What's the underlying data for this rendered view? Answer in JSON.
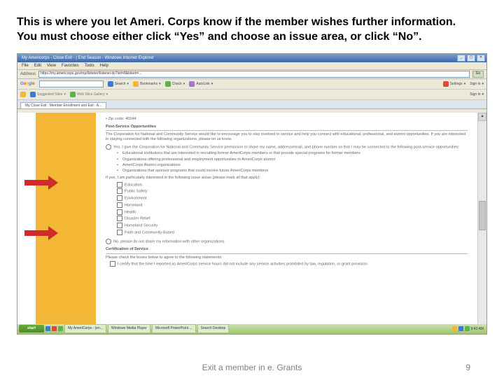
{
  "slide": {
    "header_line1": "This is where you let Ameri. Corps know if the member wishes further information.",
    "header_line2": "You must choose either click “Yes” and choose an issue area, or click “No”.",
    "footer_center": "Exit a member in e. Grants",
    "page_number": "9"
  },
  "browser": {
    "window_title": "My Americorps - Close Exit - | End Season - Windows Internet Explorer",
    "menu": [
      "File",
      "Edit",
      "View",
      "Favorites",
      "Tools",
      "Help"
    ],
    "address_label": "Address",
    "address_url": "https://my.americorps.gov/mp/listener/listener.do?sid=8&token=...",
    "go_label": "Go",
    "toolbar_labels": {
      "search": "Search",
      "bookmarks": "Bookmarks",
      "check": "Check",
      "autolink": "AutoLink",
      "settings": "Settings",
      "signin": "Sign in"
    },
    "google_placeholder": "",
    "favbar": {
      "suggested": "Suggested Sites",
      "webslice": "Web Slice Gallery"
    },
    "tab_label": "My Close Exit : Member Enrollment and Exit : A...",
    "signin_right": "Sign in"
  },
  "content": {
    "zip_line": "• Zip code: 46544",
    "section1_title": "Post-Service Opportunities",
    "intro": "The Corporation for National and Community Service would like to encourage you to stay involved in service and help you connect with educational, professional, and alumni opportunities. If you are interested in staying connected with the following organizations, please let us know.",
    "yes_text": "Yes, I give the Corporation for National and Community Service permission to share my name, address/email, and phone number so that I may be connected to the following post-service opportunities:",
    "bullets": [
      "Educational institutions that are interested in recruiting former AmeriCorps members or that provide special programs for former members",
      "Organizations offering professional and employment opportunities to AmeriCorps alumni",
      "AmeriCorps Alumni organizations",
      "Organizations that sponsor programs that could involve future AmeriCorps members"
    ],
    "if_yes": "If yes, I am particularly interested in the following issue areas (please mark all that apply):",
    "checkboxes": [
      "Education",
      "Public Safety",
      "Environment",
      "Homeland",
      "Health",
      "Disaster Relief",
      "Homeland Security",
      "Faith and Community-Based"
    ],
    "no_text": "No, please do not share my information with other organizations.",
    "section2_title": "Certification of Service",
    "cert_intro": "Please check the boxes below to agree to the following statements:",
    "cert1": "I certify that the time I reported as AmeriCorps service hours did not include any service activities prohibited by law, regulation, or grant provision."
  },
  "taskbar": {
    "start": "start",
    "buttons": [
      "My AmeriCorps - (en...",
      "Windows Media Player",
      "Microsoft PowerPoint ...",
      "Search Desktop"
    ],
    "clock": "9:43 AM"
  }
}
